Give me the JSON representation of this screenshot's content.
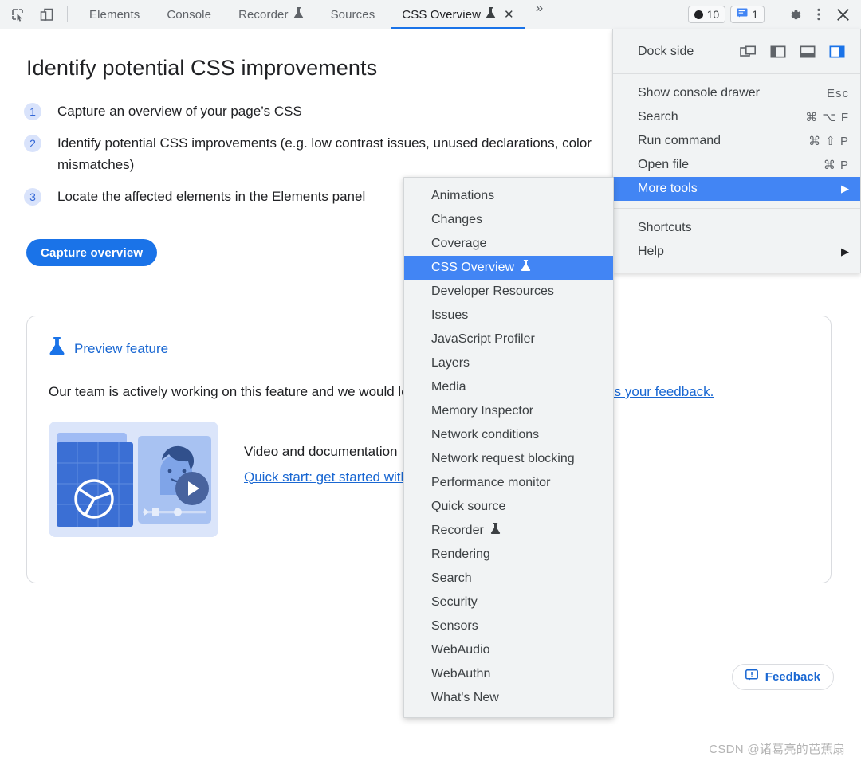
{
  "toolbar": {
    "inspect_icon": "inspect-element-icon",
    "device_icon": "device-toolbar-icon",
    "tabs": [
      {
        "label": "Elements",
        "active": false,
        "experiment": false,
        "closable": false
      },
      {
        "label": "Console",
        "active": false,
        "experiment": false,
        "closable": false
      },
      {
        "label": "Recorder",
        "active": false,
        "experiment": true,
        "closable": false
      },
      {
        "label": "Sources",
        "active": false,
        "experiment": false,
        "closable": false
      },
      {
        "label": "CSS Overview",
        "active": true,
        "experiment": true,
        "closable": true
      }
    ],
    "overflow_label": "»",
    "close_tab_label": "✕",
    "error_count": "10",
    "message_count": "1",
    "settings_icon": "gear-icon",
    "kebab_icon": "more-options-icon",
    "close_icon": "close-devtools-icon"
  },
  "main": {
    "title": "Identify potential CSS improvements",
    "steps": [
      {
        "num": "1",
        "text": "Capture an overview of your page’s CSS"
      },
      {
        "num": "2",
        "text": "Identify potential CSS improvements (e.g. low contrast issues, unused declarations, color mismatches)"
      },
      {
        "num": "3",
        "text": "Locate the affected elements in the Elements panel"
      }
    ],
    "capture_button": "Capture overview",
    "card": {
      "heading": "Preview feature",
      "heading_icon": "flask-icon",
      "body_text": "Our team is actively working on this feature and we would love to know what you think. ",
      "body_link": "Send us your feedback.",
      "media_text": "Video and documentation",
      "media_link": "Quick start: get started with the new CSS overview panel",
      "thumbnail_icon": "video-thumbnail-illustration"
    },
    "feedback_button": "Feedback",
    "feedback_icon": "feedback-icon",
    "watermark": "CSDN @诸葛亮的芭蕉扇"
  },
  "settings_menu": {
    "dock_side_label": "Dock side",
    "dock_options": [
      {
        "name": "undock-into-separate-window",
        "selected": false
      },
      {
        "name": "dock-to-left",
        "selected": false
      },
      {
        "name": "dock-to-bottom",
        "selected": false
      },
      {
        "name": "dock-to-right",
        "selected": true
      }
    ],
    "group_one": [
      {
        "label": "Show console drawer",
        "accel": "Esc",
        "selected": false,
        "arrow": false
      },
      {
        "label": "Search",
        "accel": "⌘ ⌥ F",
        "selected": false,
        "arrow": false
      },
      {
        "label": "Run command",
        "accel": "⌘ ⇧ P",
        "selected": false,
        "arrow": false
      },
      {
        "label": "Open file",
        "accel": "⌘ P",
        "selected": false,
        "arrow": false
      },
      {
        "label": "More tools",
        "accel": "",
        "selected": true,
        "arrow": true
      }
    ],
    "group_two": [
      {
        "label": "Shortcuts",
        "accel": "",
        "selected": false,
        "arrow": false
      },
      {
        "label": "Help",
        "accel": "",
        "selected": false,
        "arrow": true
      }
    ]
  },
  "more_tools_submenu": {
    "items": [
      {
        "label": "Animations",
        "selected": false,
        "experiment": false
      },
      {
        "label": "Changes",
        "selected": false,
        "experiment": false
      },
      {
        "label": "Coverage",
        "selected": false,
        "experiment": false
      },
      {
        "label": "CSS Overview",
        "selected": true,
        "experiment": true
      },
      {
        "label": "Developer Resources",
        "selected": false,
        "experiment": false
      },
      {
        "label": "Issues",
        "selected": false,
        "experiment": false
      },
      {
        "label": "JavaScript Profiler",
        "selected": false,
        "experiment": false
      },
      {
        "label": "Layers",
        "selected": false,
        "experiment": false
      },
      {
        "label": "Media",
        "selected": false,
        "experiment": false
      },
      {
        "label": "Memory Inspector",
        "selected": false,
        "experiment": false
      },
      {
        "label": "Network conditions",
        "selected": false,
        "experiment": false
      },
      {
        "label": "Network request blocking",
        "selected": false,
        "experiment": false
      },
      {
        "label": "Performance monitor",
        "selected": false,
        "experiment": false
      },
      {
        "label": "Quick source",
        "selected": false,
        "experiment": false
      },
      {
        "label": "Recorder",
        "selected": false,
        "experiment": true
      },
      {
        "label": "Rendering",
        "selected": false,
        "experiment": false
      },
      {
        "label": "Search",
        "selected": false,
        "experiment": false
      },
      {
        "label": "Security",
        "selected": false,
        "experiment": false
      },
      {
        "label": "Sensors",
        "selected": false,
        "experiment": false
      },
      {
        "label": "WebAudio",
        "selected": false,
        "experiment": false
      },
      {
        "label": "WebAuthn",
        "selected": false,
        "experiment": false
      },
      {
        "label": "What's New",
        "selected": false,
        "experiment": false
      }
    ]
  },
  "colors": {
    "accent": "#1a73e8",
    "menu_highlight": "#4285f4",
    "link": "#1967d2",
    "toolbar_bg": "#f1f3f4"
  }
}
